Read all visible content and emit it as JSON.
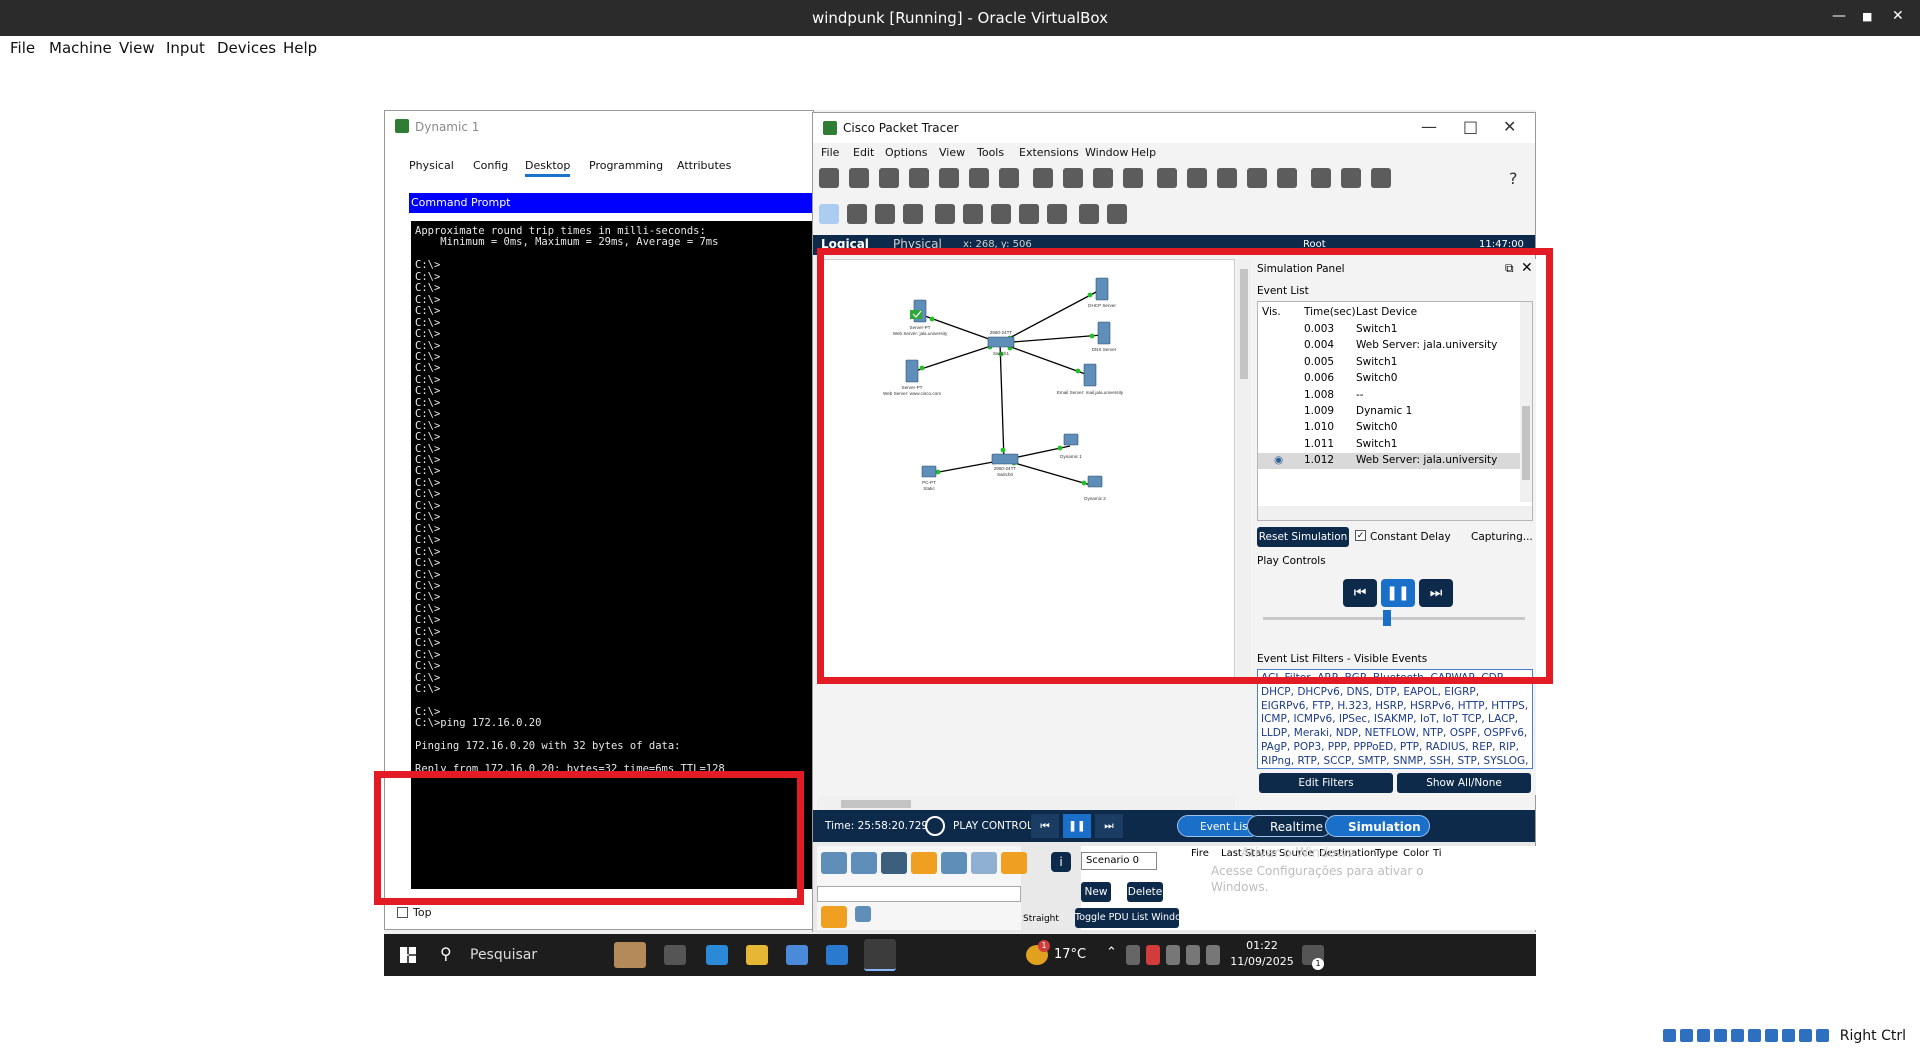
{
  "vbox": {
    "title": "windpunk [Running] - Oracle VirtualBox",
    "menu": [
      "File",
      "Machine",
      "View",
      "Input",
      "Devices",
      "Help"
    ],
    "right_ctrl": "Right Ctrl"
  },
  "dynamic": {
    "title": "Dynamic 1",
    "tabs": [
      "Physical",
      "Config",
      "Desktop",
      "Programming",
      "Attributes"
    ],
    "active_tab": "Desktop",
    "cmd_title": "Command Prompt",
    "cmd_lines": [
      "Approximate round trip times in milli-seconds:",
      "    Minimum = 0ms, Maximum = 29ms, Average = 7ms",
      "",
      "C:\\>",
      "C:\\>",
      "C:\\>",
      "C:\\>",
      "C:\\>",
      "C:\\>",
      "C:\\>",
      "C:\\>",
      "C:\\>",
      "C:\\>",
      "C:\\>",
      "C:\\>",
      "C:\\>",
      "C:\\>",
      "C:\\>",
      "C:\\>",
      "C:\\>",
      "C:\\>",
      "C:\\>",
      "C:\\>",
      "C:\\>",
      "C:\\>",
      "C:\\>",
      "C:\\>",
      "C:\\>",
      "C:\\>",
      "C:\\>",
      "C:\\>",
      "C:\\>",
      "C:\\>",
      "C:\\>",
      "C:\\>",
      "C:\\>",
      "C:\\>",
      "C:\\>",
      "C:\\>",
      "C:\\>",
      "C:\\>",
      "",
      "C:\\>",
      "C:\\>ping 172.16.0.20",
      "",
      "Pinging 172.16.0.20 with 32 bytes of data:",
      "",
      "Reply from 172.16.0.20: bytes=32 time=6ms TTL=128"
    ],
    "top_label": "Top"
  },
  "pt": {
    "title": "Cisco Packet Tracer",
    "menu": [
      "File",
      "Edit",
      "Options",
      "View",
      "Tools",
      "Extensions",
      "Window",
      "Help"
    ],
    "help_glyph": "?",
    "nav_logical": "Logical",
    "nav_physical": "Physical",
    "nav_coords": "x: 268, y: 506",
    "nav_root": "Root",
    "nav_clock": "11:47:00",
    "nodes": {
      "webserver_jala": "Web Server: jala.university",
      "server_pt_a": "Server-PT",
      "dhcp": "DHCP Server",
      "dns": "DNS Server",
      "server_pt_b": "Server-PT",
      "web_cisco": "Web Server: www.cisco.com",
      "switch1": "Switch1",
      "switch1_model": "2960-24TT",
      "email": "Email Server: mail.jala.university",
      "switch0": "Switch0",
      "switch0_model": "2960-24TT",
      "pc_static": "Static",
      "pc_dyn1": "Dynamic 1",
      "pc_dyn2": "Dynamic 2",
      "pc_pt": "PC-PT"
    },
    "sim": {
      "panel_title": "Simulation Panel",
      "event_list": "Event List",
      "columns": [
        "Vis.",
        "Time(sec)",
        "Last Device"
      ],
      "events": [
        {
          "time": "0.003",
          "device": "Switch1"
        },
        {
          "time": "0.004",
          "device": "Web Server: jala.university"
        },
        {
          "time": "0.005",
          "device": "Switch1"
        },
        {
          "time": "0.006",
          "device": "Switch0"
        },
        {
          "time": "1.008",
          "device": "--"
        },
        {
          "time": "1.009",
          "device": "Dynamic 1"
        },
        {
          "time": "1.010",
          "device": "Switch0"
        },
        {
          "time": "1.011",
          "device": "Switch1"
        },
        {
          "time": "1.012",
          "device": "Web Server: jala.university"
        }
      ],
      "reset": "Reset Simulation",
      "constant_delay": "Constant Delay",
      "capturing": "Capturing...",
      "play_controls": "Play Controls",
      "filters_title": "Event List Filters - Visible Events",
      "filters_text": "ACL Filter, ARP, BGP, Bluetooth, CAPWAP, CDP, DHCP, DHCPv6, DNS, DTP, EAPOL, EIGRP, EIGRPv6, FTP, H.323, HSRP, HSRPv6, HTTP, HTTPS, ICMP, ICMPv6, IPSec, ISAKMP, IoT, IoT TCP, LACP, LLDP, Meraki, NDP, NETFLOW, NTP, OSPF, OSPFv6, PAgP, POP3, PPP, PPPoED, PTP, RADIUS, REP, RIP, RIPng, RTP, SCCP, SMTP, SNMP, SSH, STP, SYSLOG, TACACS, TCP, TFTP, Telnet, UDP, USB, VTP",
      "edit_filters": "Edit Filters",
      "show_all": "Show All/None"
    },
    "bottom": {
      "time": "Time: 25:58:20.729",
      "play_controls": "PLAY CONTROLS:",
      "event_list": "Event List",
      "realtime": "Realtime",
      "simulation": "Simulation",
      "scenario": "Scenario 0",
      "new": "New",
      "delete": "Delete",
      "toggle_pdu": "Toggle PDU List Window",
      "pdu_cols": [
        "Fire",
        "Last Status",
        "Source",
        "Destination",
        "Type",
        "Color",
        "Ti"
      ],
      "cable": "Straight",
      "watermark1": "Ativar o Windows",
      "watermark2": "Acesse Configurações para ativar o",
      "watermark3": "Windows."
    }
  },
  "taskbar": {
    "search": "Pesquisar",
    "temp": "17°C",
    "time": "01:22",
    "date": "11/09/2025",
    "weather_badge": "1",
    "notif_badge": "1"
  }
}
